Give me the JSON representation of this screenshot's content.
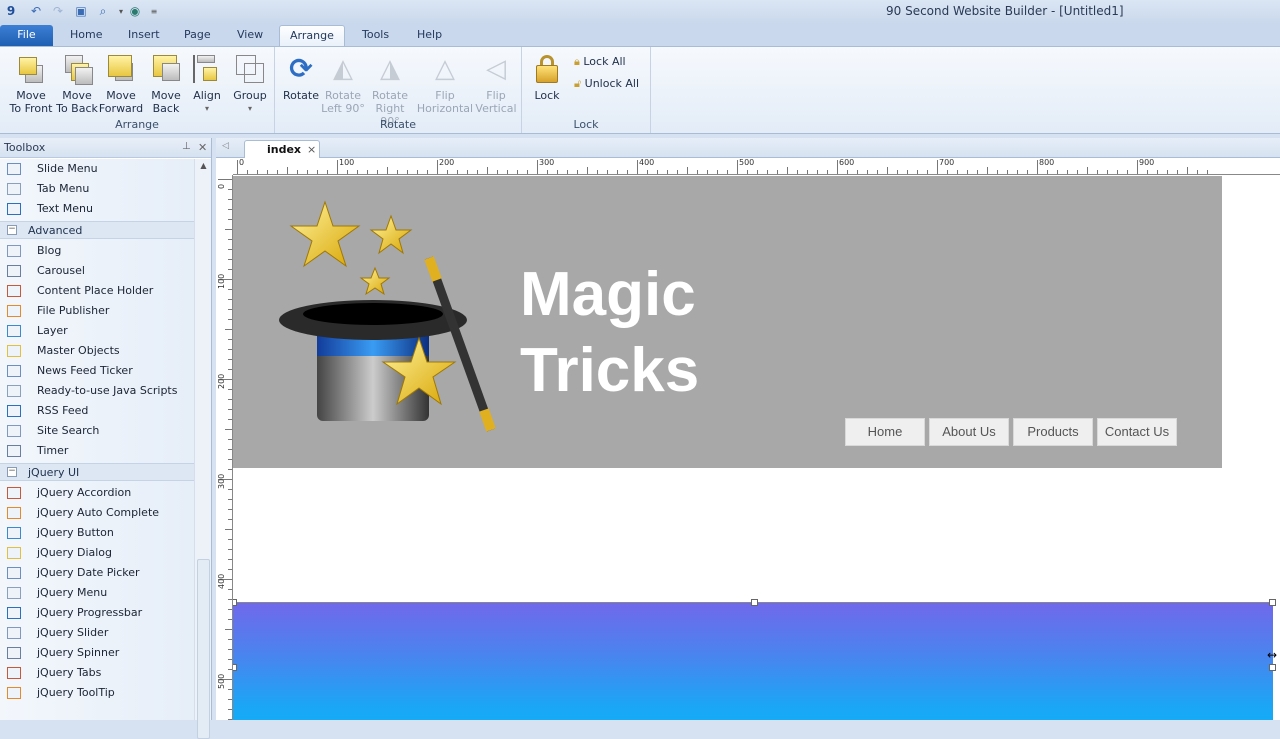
{
  "window": {
    "title": "90 Second Website Builder - [Untitled1]"
  },
  "quick_access": [
    "app-icon",
    "undo-icon",
    "redo-icon",
    "save-icon",
    "preview-icon",
    "dropdown-icon",
    "publish-icon",
    "customize-icon"
  ],
  "ribbon_tabs": [
    {
      "label": "File"
    },
    {
      "label": "Home"
    },
    {
      "label": "Insert"
    },
    {
      "label": "Page"
    },
    {
      "label": "View"
    },
    {
      "label": "Arrange",
      "active": true
    },
    {
      "label": "Tools"
    },
    {
      "label": "Help"
    }
  ],
  "ribbon": {
    "groups": [
      {
        "label": "Arrange",
        "buttons": [
          {
            "line1": "Move",
            "line2": "To Front"
          },
          {
            "line1": "Move",
            "line2": "To Back"
          },
          {
            "line1": "Move",
            "line2": "Forward"
          },
          {
            "line1": "Move",
            "line2": "Back"
          },
          {
            "line1": "Align",
            "line2": "▾"
          },
          {
            "line1": "Group",
            "line2": "▾"
          }
        ]
      },
      {
        "label": "Rotate",
        "buttons": [
          {
            "line1": "Rotate",
            "line2": ""
          },
          {
            "line1": "Rotate",
            "line2": "Left 90°",
            "disabled": true
          },
          {
            "line1": "Rotate",
            "line2": "Right 90°",
            "disabled": true
          },
          {
            "line1": "Flip",
            "line2": "Horizontal",
            "disabled": true
          },
          {
            "line1": "Flip",
            "line2": "Vertical",
            "disabled": true
          }
        ]
      },
      {
        "label": "Lock",
        "buttons": [
          {
            "line1": "Lock",
            "line2": ""
          }
        ],
        "small": [
          {
            "label": "Lock All"
          },
          {
            "label": "Unlock All"
          }
        ]
      }
    ]
  },
  "toolbox": {
    "title": "Toolbox",
    "top_items": [
      {
        "label": "Slide Menu"
      },
      {
        "label": "Tab Menu"
      },
      {
        "label": "Text Menu"
      }
    ],
    "categories": [
      {
        "label": "Advanced",
        "items": [
          {
            "label": "Blog"
          },
          {
            "label": "Carousel"
          },
          {
            "label": "Content Place Holder"
          },
          {
            "label": "File Publisher"
          },
          {
            "label": "Layer"
          },
          {
            "label": "Master Objects"
          },
          {
            "label": "News Feed Ticker"
          },
          {
            "label": "Ready-to-use Java Scripts"
          },
          {
            "label": "RSS Feed"
          },
          {
            "label": "Site Search"
          },
          {
            "label": "Timer"
          }
        ]
      },
      {
        "label": "jQuery UI",
        "items": [
          {
            "label": "jQuery Accordion"
          },
          {
            "label": "jQuery Auto Complete"
          },
          {
            "label": "jQuery Button"
          },
          {
            "label": "jQuery Dialog"
          },
          {
            "label": "jQuery Date Picker"
          },
          {
            "label": "jQuery Menu"
          },
          {
            "label": "jQuery Progressbar"
          },
          {
            "label": "jQuery Slider"
          },
          {
            "label": "jQuery Spinner"
          },
          {
            "label": "jQuery Tabs"
          },
          {
            "label": "jQuery ToolTip"
          }
        ]
      }
    ]
  },
  "document_tab": {
    "label": "index",
    "close": "×"
  },
  "rulers": {
    "horizontal": [
      "0",
      "100",
      "200",
      "300",
      "400",
      "500",
      "600",
      "700",
      "800",
      "900"
    ],
    "vertical": [
      "0",
      "100",
      "200",
      "300",
      "400",
      "500"
    ]
  },
  "page": {
    "brand_line1": "Magic",
    "brand_line2": "Tricks",
    "nav": [
      {
        "label": "Home"
      },
      {
        "label": "About Us"
      },
      {
        "label": "Products"
      },
      {
        "label": "Contact Us"
      }
    ],
    "colors": {
      "header_bg": "#a8a8a8",
      "band_top": "#7068ec",
      "band_bottom": "#10b0f8"
    }
  }
}
